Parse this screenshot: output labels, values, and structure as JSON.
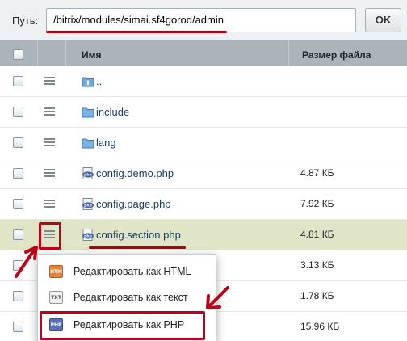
{
  "path_bar": {
    "label": "Путь:",
    "value": "/bitrix/modules/simai.sf4gorod/admin",
    "ok_label": "OK"
  },
  "table": {
    "headers": {
      "menu": "",
      "name": "Имя",
      "size": "Размер файла"
    },
    "rows": [
      {
        "name": "..",
        "size": "",
        "icon": "folder-up-icon"
      },
      {
        "name": "include",
        "size": "",
        "icon": "folder-icon"
      },
      {
        "name": "lang",
        "size": "",
        "icon": "folder-icon"
      },
      {
        "name": "config.demo.php",
        "size": "4.87 КБ",
        "icon": "php-file-icon"
      },
      {
        "name": "config.page.php",
        "size": "7.92 КБ",
        "icon": "php-file-icon"
      },
      {
        "name": "config.section.php",
        "size": "4.81 КБ",
        "icon": "php-file-icon",
        "selected": true
      },
      {
        "name": "",
        "size": "3.13 КБ",
        "icon": ""
      },
      {
        "name": "",
        "size": "1.78 КБ",
        "icon": ""
      },
      {
        "name": "",
        "size": "15.96 КБ",
        "icon": ""
      }
    ]
  },
  "context_menu": {
    "items": [
      {
        "label": "Редактировать как HTML",
        "icon": "html-file-icon",
        "badge": "HTM"
      },
      {
        "label": "Редактировать как текст",
        "icon": "txt-file-icon",
        "badge": "TXT"
      },
      {
        "label": "Редактировать как PHP",
        "icon": "php-file-icon",
        "badge": "PHP"
      }
    ]
  },
  "colors": {
    "header_bg": "#aab4b9",
    "selected_row_bg": "#dfe5c6",
    "annotation_red": "#c0001a",
    "link_text": "#1a3a5c"
  }
}
